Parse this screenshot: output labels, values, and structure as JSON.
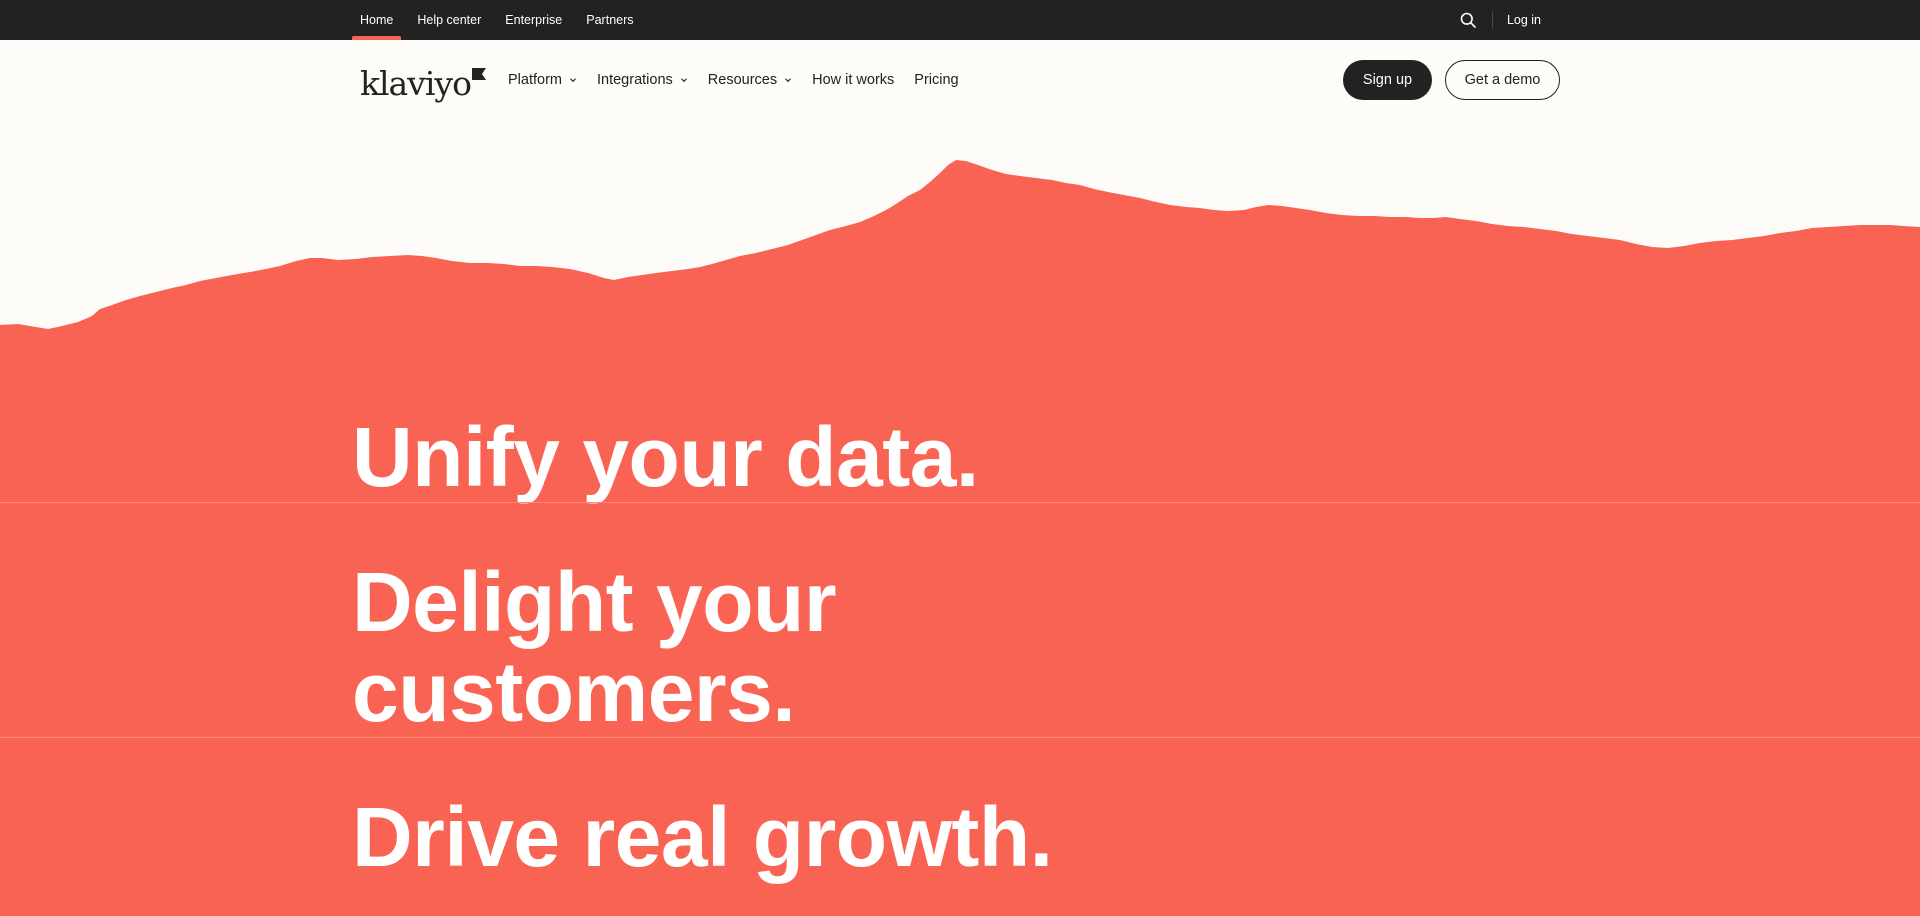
{
  "utility_nav": {
    "links": [
      {
        "label": "Home",
        "active": true
      },
      {
        "label": "Help center"
      },
      {
        "label": "Enterprise"
      },
      {
        "label": "Partners"
      }
    ],
    "search_icon": "search-icon",
    "login_label": "Log in"
  },
  "main_nav": {
    "logo_text": "klaviyo",
    "items": [
      {
        "label": "Platform",
        "dropdown": true
      },
      {
        "label": "Integrations",
        "dropdown": true
      },
      {
        "label": "Resources",
        "dropdown": true
      },
      {
        "label": "How it works"
      },
      {
        "label": "Pricing"
      }
    ],
    "signup_label": "Sign up",
    "demo_label": "Get a demo"
  },
  "hero": {
    "line1": "Unify your data.",
    "line2a": "Delight your",
    "line2b": "customers.",
    "line3": "Drive real growth."
  },
  "colors": {
    "accent": "#f96353",
    "dark": "#232121",
    "background": "#fefcf9"
  }
}
